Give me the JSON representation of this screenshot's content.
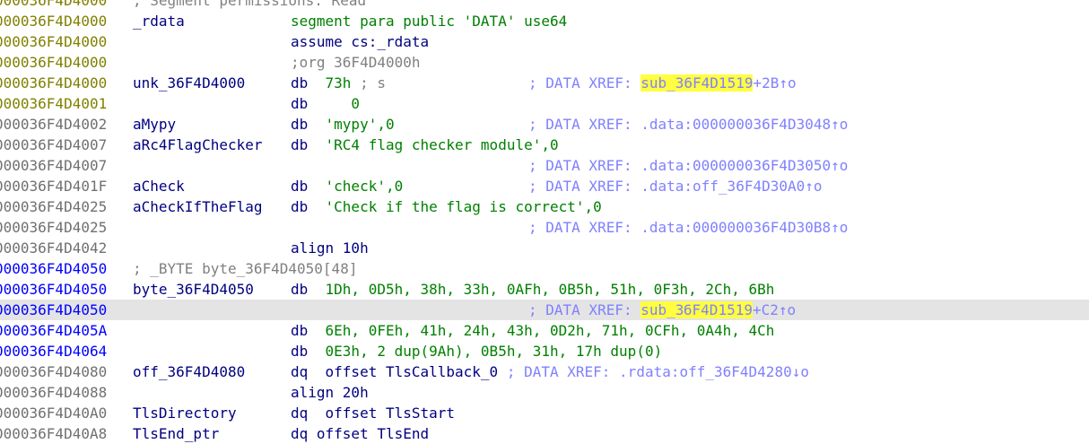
{
  "listing": {
    "top_partial": {
      "addr": "000036F4D4000",
      "text": "; Segment permissions: Read"
    },
    "lines": [
      {
        "addr": "000036F4D4000",
        "addr_color": "yellow",
        "label": "_rdata",
        "instr": "segment para public 'DATA' use64",
        "instr_style": "green"
      },
      {
        "addr": "000036F4D4000",
        "addr_color": "yellow",
        "label": "",
        "instr": "assume cs:_rdata",
        "instr_style": "navy"
      },
      {
        "addr": "000036F4D4000",
        "addr_color": "yellow",
        "label": "",
        "instr": ";org 36F4D4000h",
        "instr_style": "gray"
      },
      {
        "addr": "000036F4D4000",
        "addr_color": "yellow",
        "label": "unk_36F4D4000",
        "op": "db",
        "val": "73h",
        "extra": " ; s",
        "xref_prefix": "; DATA XREF: ",
        "xref_hl": "sub_36F4D1519",
        "xref_suffix": "+2B↑o"
      },
      {
        "addr": "000036F4D4001",
        "addr_color": "yellow",
        "label": "",
        "op": "db",
        "val": "   0"
      },
      {
        "addr": "000036F4D4002",
        "addr_color": "gray",
        "label": "aMypy",
        "op": "db",
        "str": "'mypy'",
        "tail": ",0",
        "xref_prefix": "; DATA XREF: .data:000000036F4D3048↑o"
      },
      {
        "addr": "000036F4D4007",
        "addr_color": "gray",
        "label": "aRc4FlagChecker",
        "op": "db",
        "str": "'RC4 flag checker module'",
        "tail": ",0"
      },
      {
        "addr": "000036F4D4007",
        "addr_color": "gray",
        "label": "",
        "xref_prefix": "; DATA XREF: .data:000000036F4D3050↑o"
      },
      {
        "addr": "000036F4D401F",
        "addr_color": "gray",
        "label": "aCheck",
        "op": "db",
        "str": "'check'",
        "tail": ",0",
        "xref_prefix": "; DATA XREF: .data:off_36F4D30A0↑o"
      },
      {
        "addr": "000036F4D4025",
        "addr_color": "gray",
        "label": "aCheckIfTheFlag",
        "op": "db",
        "str": "'Check if the flag is correct'",
        "tail": ",0"
      },
      {
        "addr": "000036F4D4025",
        "addr_color": "gray",
        "label": "",
        "xref_prefix": "; DATA XREF: .data:000000036F4D30B8↑o"
      },
      {
        "addr": "000036F4D4042",
        "addr_color": "gray",
        "label": "",
        "instr": "align 10h",
        "instr_style": "navy"
      },
      {
        "addr": "000036F4D4050",
        "addr_color": "blue",
        "label": "",
        "comment_line": "; _BYTE byte_36F4D4050[48]"
      },
      {
        "addr": "000036F4D4050",
        "addr_color": "blue",
        "label": "byte_36F4D4050",
        "op": "db",
        "val": "1Dh, 0D5h, 38h, 33h, 0AFh, 0B5h, 51h, 0F3h, 2Ch, 6Bh"
      },
      {
        "addr": "000036F4D4050",
        "addr_color": "blue",
        "label": "",
        "current": true,
        "xref_prefix": "; DATA XREF: ",
        "xref_hl_a": "sub_3",
        "xref_hl_b": "6F4D1519",
        "xref_suffix": "+C2↑o"
      },
      {
        "addr": "000036F4D405A",
        "addr_color": "blue",
        "label": "",
        "op": "db",
        "val": "6Eh, 0FEh, 41h, 24h, 43h, 0D2h, 71h, 0CFh, 0A4h, 4Ch"
      },
      {
        "addr": "000036F4D4064",
        "addr_color": "blue",
        "label": "",
        "op": "db",
        "val": "0E3h, 2 dup(9Ah), 0B5h, 31h, 17h dup(0)"
      },
      {
        "addr": "000036F4D4080",
        "addr_color": "gray",
        "label": "off_36F4D4080",
        "op": "dq",
        "offset": "offset TlsCallback_0",
        "xref_prefix": " ; DATA XREF: .rdata:off_36F4D4280↓o"
      },
      {
        "addr": "000036F4D4088",
        "addr_color": "gray",
        "label": "",
        "instr": "align 20h",
        "instr_style": "navy"
      },
      {
        "addr": "000036F4D40A0",
        "addr_color": "gray",
        "label": "TlsDirectory",
        "op": "dq",
        "offset": "offset TlsStart"
      }
    ],
    "bottom_partial": {
      "addr": "000036F4D40A8",
      "label": "TlsEnd_ptr",
      "instr": "dq offset TlsEnd"
    }
  },
  "colors": {
    "highlight": "#ffff40",
    "current_line": "#e4e4e4",
    "xref": "#8080ff",
    "string": "#008000",
    "label": "#000080"
  }
}
